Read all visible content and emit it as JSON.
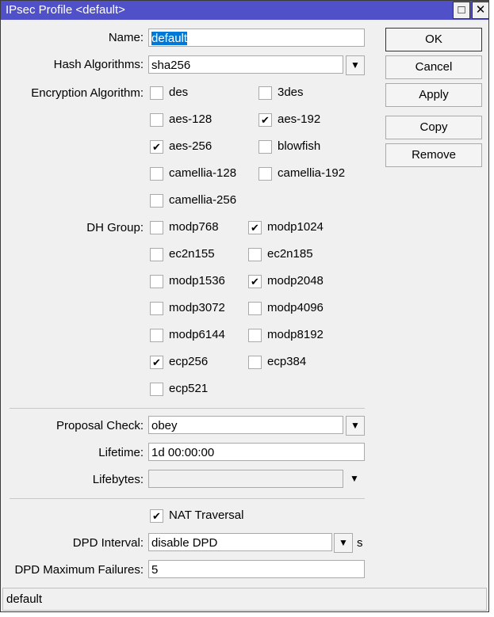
{
  "window": {
    "title": "IPsec Profile <default>",
    "maximize_icon": "□",
    "close_icon": "✕"
  },
  "fields": {
    "name_label": "Name:",
    "name_value": "default",
    "hash_label": "Hash Algorithms:",
    "hash_value": "sha256",
    "enc_label": "Encryption Algorithm:",
    "dh_label": "DH Group:",
    "proposal_label": "Proposal Check:",
    "proposal_value": "obey",
    "lifetime_label": "Lifetime:",
    "lifetime_value": "1d 00:00:00",
    "lifebytes_label": "Lifebytes:",
    "lifebytes_value": "",
    "nat_label": "NAT Traversal",
    "nat_checked": true,
    "dpd_label": "DPD Interval:",
    "dpd_value": "disable DPD",
    "dpd_unit": "s",
    "dpdmax_label": "DPD Maximum Failures:",
    "dpdmax_value": "5"
  },
  "encryption": [
    {
      "label": "des",
      "checked": false
    },
    {
      "label": "3des",
      "checked": false
    },
    {
      "label": "aes-128",
      "checked": false
    },
    {
      "label": "aes-192",
      "checked": true
    },
    {
      "label": "aes-256",
      "checked": true
    },
    {
      "label": "blowfish",
      "checked": false
    },
    {
      "label": "camellia-128",
      "checked": false
    },
    {
      "label": "camellia-192",
      "checked": false
    },
    {
      "label": "camellia-256",
      "checked": false
    }
  ],
  "dh_groups": [
    {
      "label": "modp768",
      "checked": false
    },
    {
      "label": "modp1024",
      "checked": true
    },
    {
      "label": "ec2n155",
      "checked": false
    },
    {
      "label": "ec2n185",
      "checked": false
    },
    {
      "label": "modp1536",
      "checked": false
    },
    {
      "label": "modp2048",
      "checked": true
    },
    {
      "label": "modp3072",
      "checked": false
    },
    {
      "label": "modp4096",
      "checked": false
    },
    {
      "label": "modp6144",
      "checked": false
    },
    {
      "label": "modp8192",
      "checked": false
    },
    {
      "label": "ecp256",
      "checked": true
    },
    {
      "label": "ecp384",
      "checked": false
    },
    {
      "label": "ecp521",
      "checked": false
    }
  ],
  "buttons": {
    "ok": "OK",
    "cancel": "Cancel",
    "apply": "Apply",
    "copy": "Copy",
    "remove": "Remove"
  },
  "status": "default"
}
